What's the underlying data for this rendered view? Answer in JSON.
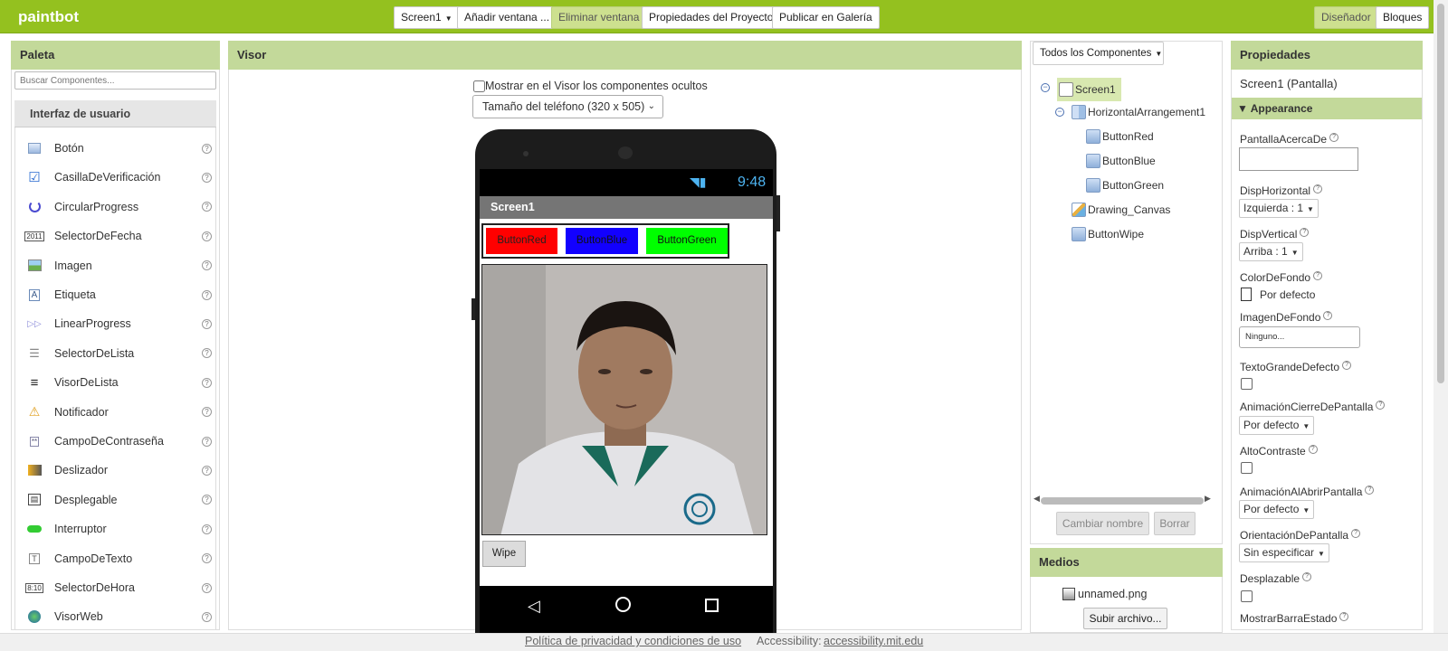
{
  "app": {
    "name": "paintbot"
  },
  "toolbar": {
    "screen_select": "Screen1",
    "add_screen": "Añadir ventana ...",
    "remove_screen": "Eliminar ventana",
    "project_props": "Propiedades del Proyecto",
    "publish": "Publicar en Galería",
    "designer": "Diseñador",
    "blocks": "Bloques"
  },
  "palette": {
    "title": "Paleta",
    "search_placeholder": "Buscar Componentes...",
    "section": "Interfaz de usuario",
    "items": [
      {
        "label": "Botón",
        "icon": "button-icon"
      },
      {
        "label": "CasillaDeVerificación",
        "icon": "checkbox-icon"
      },
      {
        "label": "CircularProgress",
        "icon": "circular-progress-icon"
      },
      {
        "label": "SelectorDeFecha",
        "icon": "date-picker-icon"
      },
      {
        "label": "Imagen",
        "icon": "image-icon"
      },
      {
        "label": "Etiqueta",
        "icon": "label-icon"
      },
      {
        "label": "LinearProgress",
        "icon": "linear-progress-icon"
      },
      {
        "label": "SelectorDeLista",
        "icon": "list-picker-icon"
      },
      {
        "label": "VisorDeLista",
        "icon": "list-view-icon"
      },
      {
        "label": "Notificador",
        "icon": "notifier-icon"
      },
      {
        "label": "CampoDeContraseña",
        "icon": "password-icon"
      },
      {
        "label": "Deslizador",
        "icon": "slider-icon"
      },
      {
        "label": "Desplegable",
        "icon": "spinner-icon"
      },
      {
        "label": "Interruptor",
        "icon": "switch-icon"
      },
      {
        "label": "CampoDeTexto",
        "icon": "textbox-icon"
      },
      {
        "label": "SelectorDeHora",
        "icon": "time-picker-icon"
      },
      {
        "label": "VisorWeb",
        "icon": "webviewer-icon"
      }
    ],
    "help": "?"
  },
  "viewer": {
    "title": "Visor",
    "show_hidden": "Mostrar en el Visor los componentes ocultos",
    "phone_size": "Tamaño del teléfono (320 x 505)",
    "time": "9:48",
    "screen_title": "Screen1",
    "buttons": {
      "red": "ButtonRed",
      "blue": "ButtonBlue",
      "green": "ButtonGreen"
    },
    "wipe": "Wipe"
  },
  "components": {
    "dropdown": "Todos los Componentes",
    "tree": [
      "Screen1",
      "HorizontalArrangement1",
      "ButtonRed",
      "ButtonBlue",
      "ButtonGreen",
      "Drawing_Canvas",
      "ButtonWipe"
    ],
    "rename": "Cambiar nombre",
    "delete": "Borrar"
  },
  "media": {
    "title": "Medios",
    "file": "unnamed.png",
    "upload": "Subir archivo..."
  },
  "properties": {
    "title": "Propiedades",
    "subtitle": "Screen1 (Pantalla)",
    "section": "Appearance",
    "about": "PantallaAcercaDe",
    "halign": "DispHorizontal",
    "halign_value": "Izquierda : 1",
    "valign": "DispVertical",
    "valign_value": "Arriba : 1",
    "bgcolor": "ColorDeFondo",
    "bgcolor_value": "Por defecto",
    "bgimage": "ImagenDeFondo",
    "bgimage_value": "Ninguno...",
    "bigtext": "TextoGrandeDefecto",
    "close_anim": "AnimaciónCierreDePantalla",
    "close_anim_value": "Por defecto",
    "contrast": "AltoContraste",
    "open_anim": "AnimaciónAlAbrirPantalla",
    "open_anim_value": "Por defecto",
    "orientation": "OrientaciónDePantalla",
    "orientation_value": "Sin especificar",
    "scrollable": "Desplazable",
    "statusbar": "MostrarBarraEstado"
  },
  "footer": {
    "privacy": "Política de privacidad y condiciones de uso",
    "accessibility_label": "Accessibility:",
    "accessibility_link": "accessibility.mit.edu"
  }
}
